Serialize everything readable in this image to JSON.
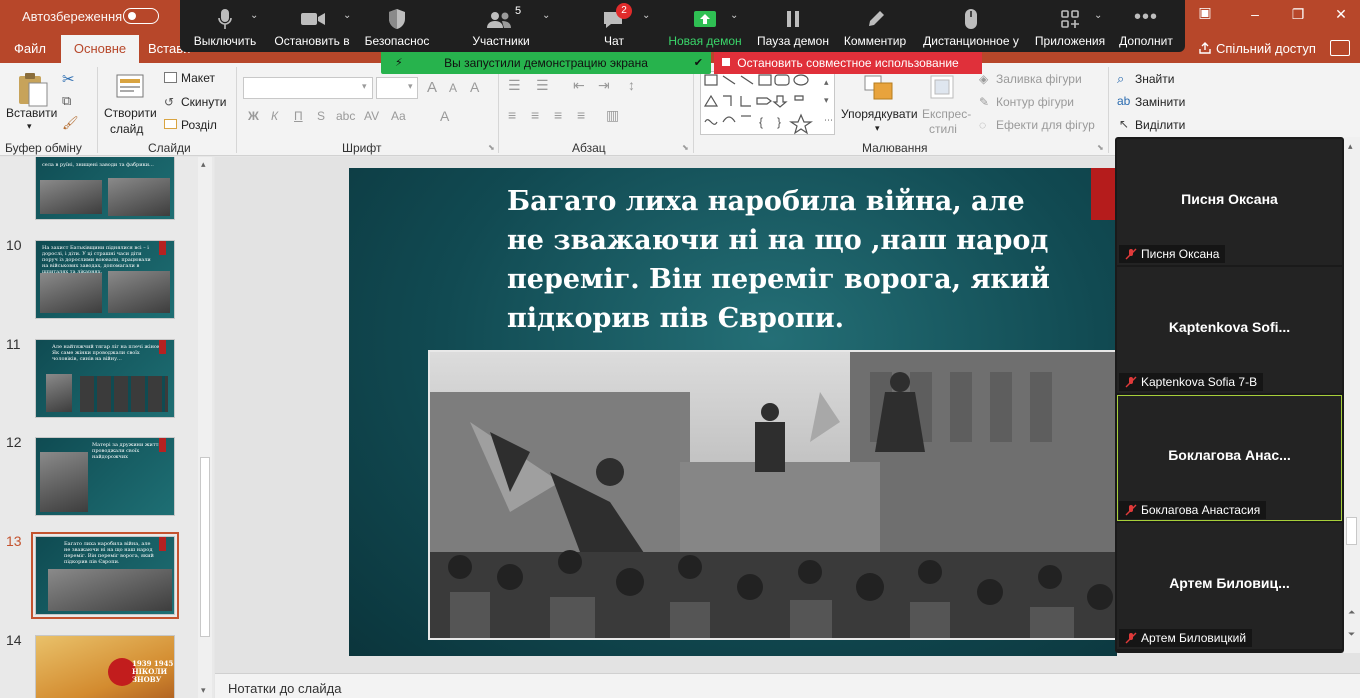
{
  "titlebar": {
    "autosave_label": "Автозбереження",
    "min": "–",
    "restore": "❐",
    "close": "✕"
  },
  "tabs": {
    "file": "Файл",
    "home": "Основне",
    "insert": "Встави",
    "share": "Спільний доступ"
  },
  "ribbon": {
    "clipboard": {
      "paste": "Вставити",
      "label": "Буфер обміну"
    },
    "slides": {
      "new_slide_line1": "Створити",
      "new_slide_line2": "слайд",
      "layout": "Макет",
      "reset": "Скинути",
      "section": "Розділ",
      "label": "Слайди"
    },
    "font": {
      "label": "Шрифт",
      "bold": "Ж",
      "italic": "К",
      "underline": "П",
      "strike": "S",
      "abc": "abc",
      "spacing": "AV",
      "case": "Aa"
    },
    "paragraph": {
      "label": "Абзац"
    },
    "drawing": {
      "arrange": "Упорядкувати",
      "styles_line1": "Експрес-",
      "styles_line2": "стилі",
      "fill": "Заливка фігури",
      "outline": "Контур фігури",
      "effects": "Ефекти для фігур",
      "label": "Малювання"
    },
    "editing": {
      "find": "Знайти",
      "replace": "Замінити",
      "select": "Виділити"
    }
  },
  "zoom": {
    "mute": "Выключить",
    "video": "Остановить в",
    "security": "Безопаснос",
    "participants": "Участники",
    "participants_count": "5",
    "chat": "Чат",
    "chat_count": "2",
    "new_share": "Новая демон",
    "pause_share": "Пауза демон",
    "annotate": "Комментир",
    "remote": "Дистанционное у",
    "apps": "Приложения",
    "more": "Дополнит",
    "sharing_banner": "Вы запустили демонстрацию экрана",
    "stop_share": "Остановить совместное использование",
    "colors": {
      "bar": "#1f1f1f",
      "share_green": "#27b34d",
      "stop_red": "#e0303a"
    }
  },
  "thumbnails": [
    {
      "num": "",
      "text": "села в руїні, знищені заводи та фабрики..."
    },
    {
      "num": "10",
      "text": "На захист Батьківщини піднялися всі – і дорослі, і діти. У ці страшні часи діти поруч із дорослими воювали, працювали на військових заводах, допомагали в шпиталях та лікарнях."
    },
    {
      "num": "11",
      "text": "Але найтяжчий тягар ліг на плечі жінок. Як саме жінки проводжали своїх чоловіків, синів на війну..."
    },
    {
      "num": "12",
      "text": "Матері за дружини життя проводжали своїх найдорожчих"
    },
    {
      "num": "13",
      "text": "Багато лиха наробила війна, але не зважаючи ні на що наш народ переміг. Він переміг ворога, який підкорив пів Європи."
    },
    {
      "num": "14",
      "text": "1939 1945 НІКОЛИ ЗНОВУ"
    }
  ],
  "slide": {
    "title": "Багато лиха наробила війна, але не зважаючи ні на що ,наш народ переміг. Він переміг ворога, який підкорив пів Європи."
  },
  "notes_placeholder": "Нотатки до слайда",
  "gallery": [
    {
      "display": "Писня Оксана",
      "footer": "Писня Оксана",
      "active": false
    },
    {
      "display": "Kaptenkova Sofi...",
      "footer": "Kaptenkova Sofia 7-B",
      "active": false
    },
    {
      "display": "Боклагова Анас...",
      "footer": "Боклагова Анастасия",
      "active": true
    },
    {
      "display": "Артем Биловиц...",
      "footer": "Артем Биловицкий",
      "active": false
    }
  ]
}
